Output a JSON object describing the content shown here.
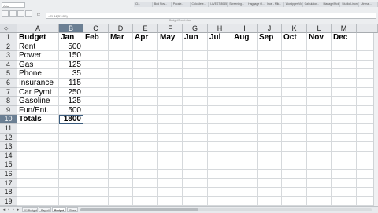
{
  "window": {
    "name_box": "Arial",
    "formula_value": "=SUM(B2:B9)",
    "doc_title": "BudgetSheet.xlsx",
    "browser_tabs": [
      "Cl...",
      "Bud Nov...",
      "Pocale...",
      "ColoMete...",
      "LIVEST 8065...",
      "Screening...",
      "Haggage O...",
      "Inoe - Mik...",
      "Wordpper Videos...",
      "Calculator...",
      "Manage/Pick Voice...",
      "Studio Linoner...",
      "Uinmal..."
    ]
  },
  "columns": [
    "A",
    "B",
    "C",
    "D",
    "E",
    "F",
    "G",
    "H",
    "I",
    "J",
    "K",
    "L",
    "M"
  ],
  "selected_column": "B",
  "rows": [
    "1",
    "2",
    "3",
    "4",
    "5",
    "6",
    "7",
    "8",
    "9",
    "10",
    "11",
    "12",
    "13",
    "14",
    "15",
    "16",
    "17",
    "18",
    "19"
  ],
  "selected_row": "10",
  "sheet": {
    "header": {
      "label": "Budget",
      "months": [
        "Jan",
        "Feb",
        "Mar",
        "Apr",
        "May",
        "Jun",
        "Jul",
        "Aug",
        "Sep",
        "Oct",
        "Nov",
        "Dec"
      ]
    },
    "items": [
      {
        "label": "Rent",
        "jan": "500"
      },
      {
        "label": "Power",
        "jan": "150"
      },
      {
        "label": "Gas",
        "jan": "125"
      },
      {
        "label": "Phone",
        "jan": "35"
      },
      {
        "label": "Insurance",
        "jan": "115"
      },
      {
        "label": "Car Pymt",
        "jan": "250"
      },
      {
        "label": "Gasoline",
        "jan": "125"
      },
      {
        "label": "Fun/Ent.",
        "jan": "500"
      }
    ],
    "total": {
      "label": "Totals",
      "jan": "1800"
    }
  },
  "sheet_tabs": [
    "01 Budget",
    "Payroll",
    "Budget",
    "Sheet"
  ],
  "active_sheet_tab": "Budget",
  "icons": {
    "corner": "select-all-icon",
    "nav": [
      "first-sheet-icon",
      "prev-sheet-icon",
      "next-sheet-icon",
      "last-sheet-icon"
    ]
  }
}
